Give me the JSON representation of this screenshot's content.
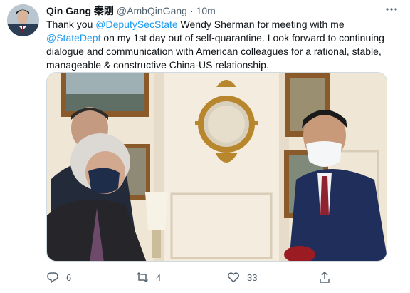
{
  "tweet": {
    "display_name": "Qin Gang 秦刚",
    "handle": "@AmbQinGang",
    "separator": "·",
    "time": "10m",
    "more_icon": "more-horizontal-icon",
    "text": {
      "part1": "Thank you ",
      "mention1": "@DeputySecState",
      "part2": " Wendy Sherman for meeting with me ",
      "mention2": "@StateDept",
      "part3": " on my 1st day out of self-quarantine. Look forward to continuing dialogue and communication with American colleagues for a rational, stable, manageable & constructive China-US relationship."
    },
    "link_color": "#1d9bf0"
  },
  "actions": {
    "reply": {
      "icon": "reply-icon",
      "count": "6"
    },
    "retweet": {
      "icon": "retweet-icon",
      "count": "4"
    },
    "like": {
      "icon": "heart-icon",
      "count": "33"
    },
    "share": {
      "icon": "share-icon"
    }
  }
}
